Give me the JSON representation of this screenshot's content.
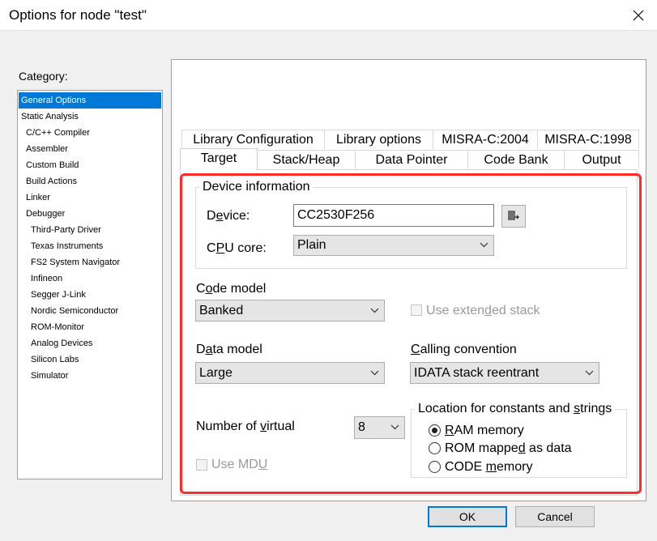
{
  "window": {
    "title": "Options for node \"test\""
  },
  "category": {
    "label": "Category:",
    "items": [
      {
        "label": "General Options",
        "selected": true
      },
      {
        "label": "Static Analysis",
        "selected": false
      },
      {
        "label": "C/C++ Compiler",
        "selected": false
      },
      {
        "label": "Assembler",
        "selected": false
      },
      {
        "label": "Custom Build",
        "selected": false
      },
      {
        "label": "Build Actions",
        "selected": false
      },
      {
        "label": "Linker",
        "selected": false
      },
      {
        "label": "Debugger",
        "selected": false
      },
      {
        "label": "Third-Party Driver",
        "selected": false
      },
      {
        "label": "Texas Instruments",
        "selected": false
      },
      {
        "label": "FS2 System Navigator",
        "selected": false
      },
      {
        "label": "Infineon",
        "selected": false
      },
      {
        "label": "Segger J-Link",
        "selected": false
      },
      {
        "label": "Nordic Semiconductor",
        "selected": false
      },
      {
        "label": "ROM-Monitor",
        "selected": false
      },
      {
        "label": "Analog Devices",
        "selected": false
      },
      {
        "label": "Silicon Labs",
        "selected": false
      },
      {
        "label": "Simulator",
        "selected": false
      }
    ]
  },
  "tabs": {
    "row1": [
      "Library Configuration",
      "Library options",
      "MISRA-C:2004",
      "MISRA-C:1998"
    ],
    "row2": [
      "Target",
      "Stack/Heap",
      "Data Pointer",
      "Code Bank",
      "Output"
    ],
    "active": "Target"
  },
  "device_info": {
    "legend": "Device information",
    "device_label_pre": "D",
    "device_label_ul": "e",
    "device_label_post": "vice:",
    "device_value": "CC2530F256",
    "cpu_label_pre": "C",
    "cpu_label_ul": "P",
    "cpu_label_post": "U core:",
    "cpu_value": "Plain"
  },
  "code_model": {
    "label_pre": "C",
    "label_ul": "o",
    "label_post": "de model",
    "value": "Banked"
  },
  "extended_stack": {
    "label_pre": "Use exten",
    "label_ul": "d",
    "label_post": "ed stack",
    "checked": false,
    "enabled": false
  },
  "data_model": {
    "label_pre": "D",
    "label_ul": "a",
    "label_post": "ta model",
    "value": "Large"
  },
  "calling_convention": {
    "label_pre": "",
    "label_ul": "C",
    "label_post": "alling convention",
    "value": "IDATA stack reentrant"
  },
  "virtual": {
    "label_pre": "Number of ",
    "label_ul": "v",
    "label_post": "irtual",
    "value": "8"
  },
  "mdu": {
    "label_pre": "Use MD",
    "label_ul": "U",
    "label_post": "",
    "checked": false,
    "enabled": false
  },
  "location": {
    "legend_pre": "Location for constants and ",
    "legend_ul": "s",
    "legend_post": "trings",
    "options": [
      {
        "pre": "",
        "ul": "R",
        "post": "AM memory",
        "selected": true
      },
      {
        "pre": "ROM mappe",
        "ul": "d",
        "post": " as data",
        "selected": false
      },
      {
        "pre": "CODE ",
        "ul": "m",
        "post": "emory",
        "selected": false
      }
    ]
  },
  "buttons": {
    "ok": "OK",
    "cancel": "Cancel"
  },
  "colors": {
    "accent": "#0078d7",
    "highlight_frame": "#ff2a2a"
  },
  "icons": {
    "close": "close-icon",
    "device_browse": "device-select-icon",
    "dropdown": "chevron-down-icon"
  }
}
